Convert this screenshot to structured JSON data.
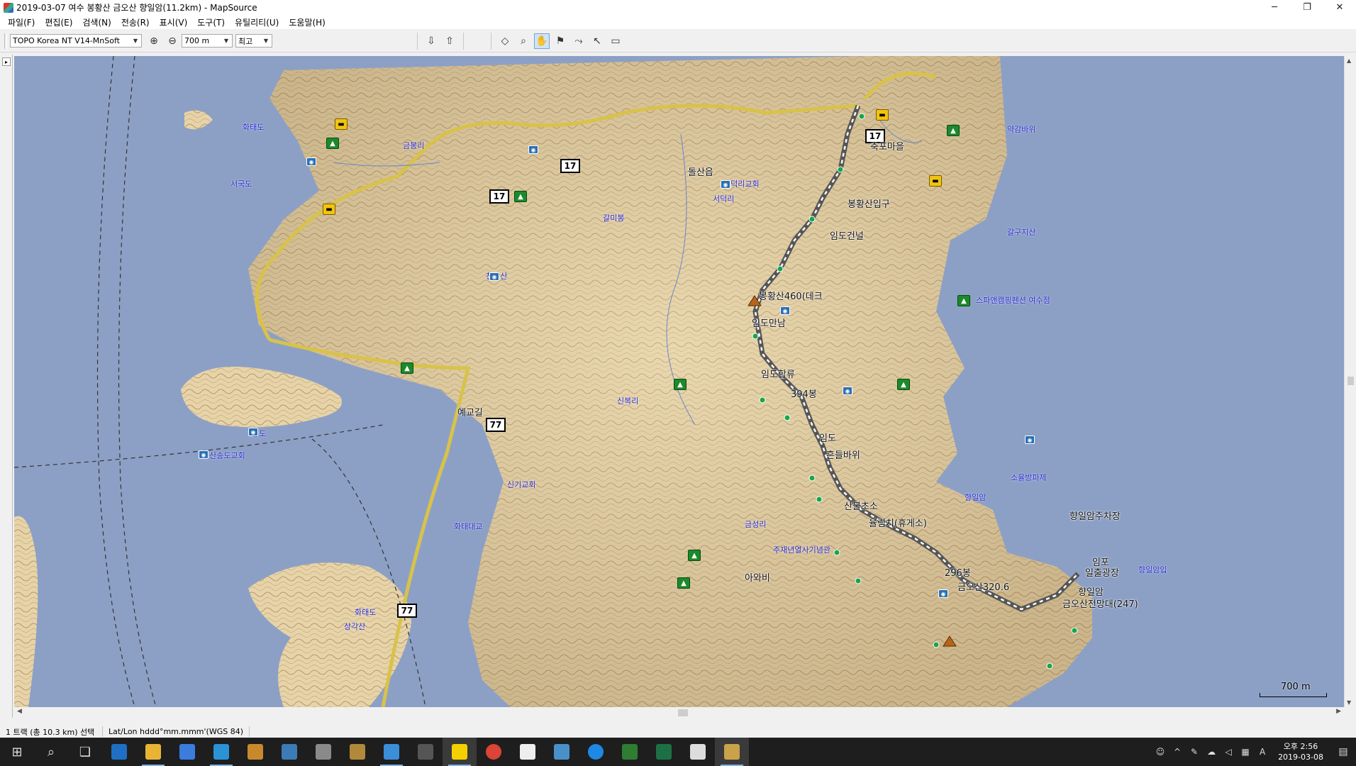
{
  "window": {
    "title": "2019-03-07 여수 봉황산 금오산 향일암(11.2km) - MapSource",
    "minimize": "─",
    "restore": "❐",
    "close": "✕"
  },
  "menu": [
    "파일(F)",
    "편집(E)",
    "검색(N)",
    "전송(R)",
    "표시(V)",
    "도구(T)",
    "유틸리티(U)",
    "도움말(H)"
  ],
  "toolbar": {
    "map_product": "TOPO Korea NT V14-MnSoft",
    "zoom_level": "700 m",
    "detail": "최고"
  },
  "map": {
    "scale_label": "700 m",
    "road_signs": [
      "17",
      "17",
      "17",
      "77",
      "77"
    ],
    "labels_dark": [
      "봉황산입구",
      "임도건널",
      "봉황산460(데크",
      "임도만남",
      "임도합류",
      "394봉",
      "임도",
      "흔들바위",
      "산불초소",
      "율림치(휴게소)",
      "296봉",
      "금오산320.6",
      "금오산전망대(247)",
      "향일암",
      "향일암주차장",
      "예교길",
      "돌산읍",
      "축포마을",
      "임포",
      "일출광장",
      "아와비"
    ],
    "labels_blue": [
      "화태도",
      "서국도",
      "금봉리",
      "서덕리교회",
      "서덕리",
      "갈미봉",
      "천왕산",
      "송도",
      "돌산송도교회",
      "신기교회",
      "화태대교",
      "주재년열사기념관",
      "스파앤캠핑펜션 여수점",
      "소율방파제",
      "향일암",
      "갈구지산",
      "약감바위",
      "금성리",
      "신복리",
      "화태도",
      "상각산",
      "향일암입"
    ]
  },
  "status": {
    "selection": "1 트랙 (총 10.3 km) 선택",
    "coords": "Lat/Lon hddd°mm.mmm'(WGS 84)"
  },
  "taskbar": {
    "clock_time": "오후 2:56",
    "clock_date": "2019-03-08",
    "ime": "A"
  }
}
